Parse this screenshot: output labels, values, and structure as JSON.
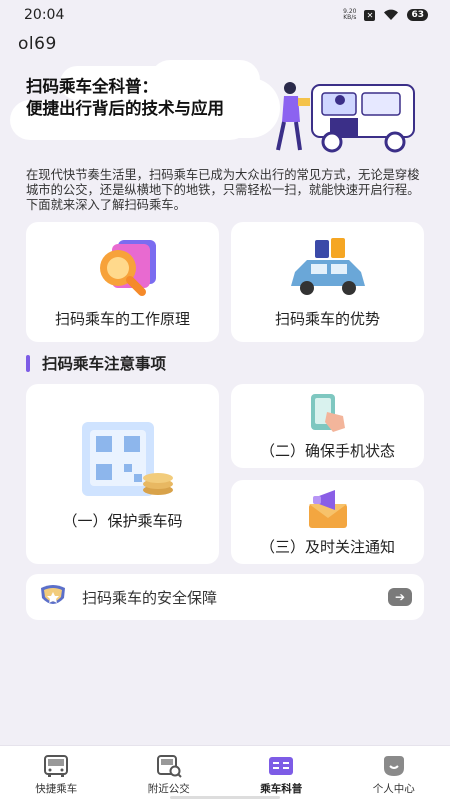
{
  "status_bar": {
    "time": "20:04",
    "net_speed_value": "9.20",
    "net_speed_unit": "KB/s",
    "battery": "63"
  },
  "app": {
    "name": "ol69"
  },
  "hero": {
    "title_line1": "扫码乘车全科普：",
    "title_line2": "便捷出行背后的技术与应用"
  },
  "intro": "在现代快节奏生活里，扫码乘车已成为大众出行的常见方式，无论是穿梭城市的公交，还是纵横地下的地铁，只需轻松一扫，就能快速开启行程。下面就来深入了解扫码乘车。",
  "cards_top": [
    {
      "label": "扫码乘车的工作原理",
      "icon": "magnifier-illustration-icon"
    },
    {
      "label": "扫码乘车的优势",
      "icon": "car-luggage-illustration-icon"
    }
  ],
  "section": {
    "title": "扫码乘车注意事项"
  },
  "notice_cards": {
    "protect": "（一）保护乘车码",
    "phone": "（二）确保手机状态",
    "notify": "（三）及时关注通知"
  },
  "safety": {
    "label": "扫码乘车的安全保障"
  },
  "tabs": [
    {
      "label": "快捷乘车",
      "icon": "bus-icon"
    },
    {
      "label": "附近公交",
      "icon": "bus-search-icon"
    },
    {
      "label": "乘车科普",
      "icon": "book-icon",
      "active": true
    },
    {
      "label": "个人中心",
      "icon": "profile-icon"
    }
  ],
  "colors": {
    "accent": "#7d5ce6",
    "background": "#f1eff6"
  }
}
